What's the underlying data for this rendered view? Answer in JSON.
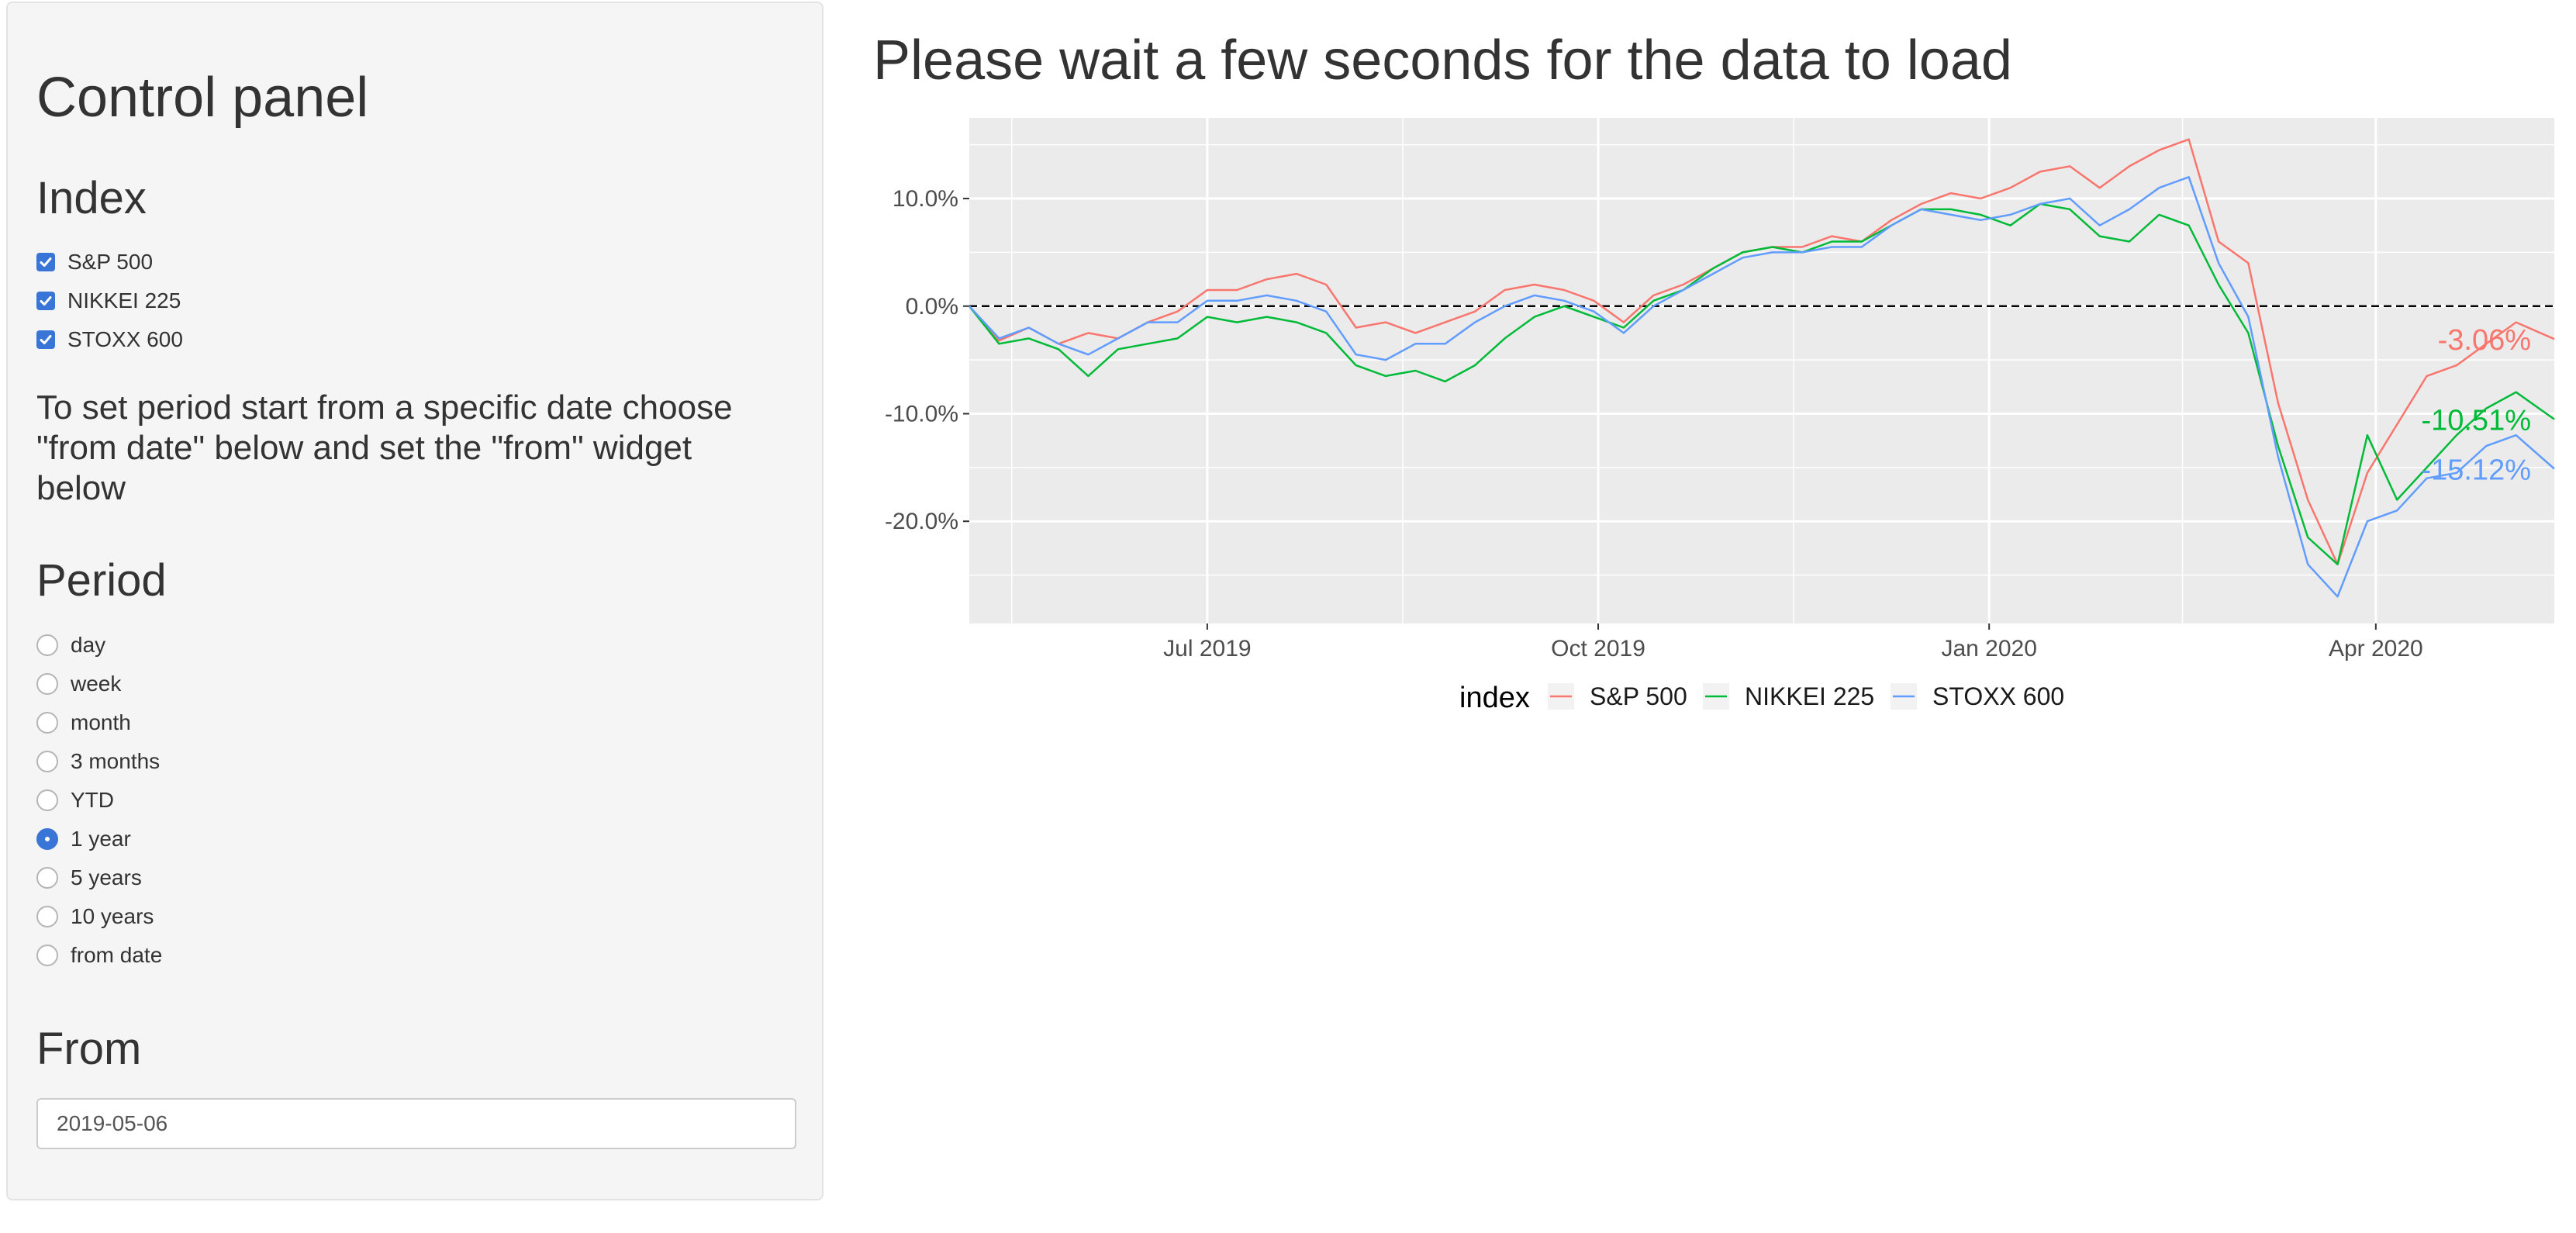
{
  "sidebar": {
    "title": "Control panel",
    "index": {
      "heading": "Index",
      "items": [
        {
          "label": "S&P 500",
          "checked": true
        },
        {
          "label": "NIKKEI 225",
          "checked": true
        },
        {
          "label": "STOXX 600",
          "checked": true
        }
      ]
    },
    "note": "To set period start from a specific date choose \"from date\" below and set the \"from\" widget below",
    "period": {
      "heading": "Period",
      "options": [
        "day",
        "week",
        "month",
        "3 months",
        "YTD",
        "1 year",
        "5 years",
        "10 years",
        "from date"
      ],
      "selected": "1 year"
    },
    "from": {
      "heading": "From",
      "value": "2019-05-06"
    }
  },
  "main": {
    "title": "Please wait a few seconds for the data to load"
  },
  "colors": {
    "sp500": "#F8766D",
    "nikkei": "#00BA38",
    "stoxx": "#619CFF",
    "accent": "#3875d7",
    "panel_bg": "#EBEBEB"
  },
  "chart_data": {
    "type": "line",
    "x_axis": {
      "type": "date",
      "range": [
        "2019-05-06",
        "2020-05-13"
      ],
      "tick_labels": [
        {
          "date": "2019-07-01",
          "label": "Jul 2019"
        },
        {
          "date": "2019-10-01",
          "label": "Oct 2019"
        },
        {
          "date": "2020-01-01",
          "label": "Jan 2020"
        },
        {
          "date": "2020-04-01",
          "label": "Apr 2020"
        }
      ]
    },
    "y_axis": {
      "unit": "percent",
      "range": [
        -29.5,
        17.5
      ],
      "ticks": [
        10,
        0,
        -10,
        -20
      ],
      "tick_labels": [
        "10.0%",
        "0.0%",
        "-10.0%",
        "-20.0%"
      ]
    },
    "reference_line": {
      "y": 0,
      "style": "dashed"
    },
    "grid": true,
    "legend": {
      "title": "index",
      "position": "bottom",
      "entries": [
        "S&P 500",
        "NIKKEI 225",
        "STOXX 600"
      ]
    },
    "series": [
      {
        "name": "S&P 500",
        "color": "#F8766D",
        "end_label": "-3.06%",
        "points": [
          [
            "2019-05-06",
            0.0
          ],
          [
            "2019-05-13",
            -3.2
          ],
          [
            "2019-05-20",
            -2.0
          ],
          [
            "2019-05-27",
            -3.5
          ],
          [
            "2019-06-03",
            -2.5
          ],
          [
            "2019-06-10",
            -3.0
          ],
          [
            "2019-06-17",
            -1.5
          ],
          [
            "2019-06-24",
            -0.5
          ],
          [
            "2019-07-01",
            1.5
          ],
          [
            "2019-07-08",
            1.5
          ],
          [
            "2019-07-15",
            2.5
          ],
          [
            "2019-07-22",
            3.0
          ],
          [
            "2019-07-29",
            2.0
          ],
          [
            "2019-08-05",
            -2.0
          ],
          [
            "2019-08-12",
            -1.5
          ],
          [
            "2019-08-19",
            -2.5
          ],
          [
            "2019-08-26",
            -1.5
          ],
          [
            "2019-09-02",
            -0.5
          ],
          [
            "2019-09-09",
            1.5
          ],
          [
            "2019-09-16",
            2.0
          ],
          [
            "2019-09-23",
            1.5
          ],
          [
            "2019-09-30",
            0.5
          ],
          [
            "2019-10-07",
            -1.5
          ],
          [
            "2019-10-14",
            1.0
          ],
          [
            "2019-10-21",
            2.0
          ],
          [
            "2019-10-28",
            3.5
          ],
          [
            "2019-11-04",
            5.0
          ],
          [
            "2019-11-11",
            5.5
          ],
          [
            "2019-11-18",
            5.5
          ],
          [
            "2019-11-25",
            6.5
          ],
          [
            "2019-12-02",
            6.0
          ],
          [
            "2019-12-09",
            8.0
          ],
          [
            "2019-12-16",
            9.5
          ],
          [
            "2019-12-23",
            10.5
          ],
          [
            "2019-12-30",
            10.0
          ],
          [
            "2020-01-06",
            11.0
          ],
          [
            "2020-01-13",
            12.5
          ],
          [
            "2020-01-20",
            13.0
          ],
          [
            "2020-01-27",
            11.0
          ],
          [
            "2020-02-03",
            13.0
          ],
          [
            "2020-02-10",
            14.5
          ],
          [
            "2020-02-17",
            15.5
          ],
          [
            "2020-02-24",
            6.0
          ],
          [
            "2020-03-02",
            4.0
          ],
          [
            "2020-03-09",
            -9.0
          ],
          [
            "2020-03-16",
            -18.0
          ],
          [
            "2020-03-23",
            -24.0
          ],
          [
            "2020-03-30",
            -15.5
          ],
          [
            "2020-04-06",
            -11.0
          ],
          [
            "2020-04-13",
            -6.5
          ],
          [
            "2020-04-20",
            -5.5
          ],
          [
            "2020-04-27",
            -3.5
          ],
          [
            "2020-05-04",
            -1.5
          ],
          [
            "2020-05-13",
            -3.06
          ]
        ]
      },
      {
        "name": "NIKKEI 225",
        "color": "#00BA38",
        "end_label": "-10.51%",
        "points": [
          [
            "2019-05-06",
            0.0
          ],
          [
            "2019-05-13",
            -3.5
          ],
          [
            "2019-05-20",
            -3.0
          ],
          [
            "2019-05-27",
            -4.0
          ],
          [
            "2019-06-03",
            -6.5
          ],
          [
            "2019-06-10",
            -4.0
          ],
          [
            "2019-06-17",
            -3.5
          ],
          [
            "2019-06-24",
            -3.0
          ],
          [
            "2019-07-01",
            -1.0
          ],
          [
            "2019-07-08",
            -1.5
          ],
          [
            "2019-07-15",
            -1.0
          ],
          [
            "2019-07-22",
            -1.5
          ],
          [
            "2019-07-29",
            -2.5
          ],
          [
            "2019-08-05",
            -5.5
          ],
          [
            "2019-08-12",
            -6.5
          ],
          [
            "2019-08-19",
            -6.0
          ],
          [
            "2019-08-26",
            -7.0
          ],
          [
            "2019-09-02",
            -5.5
          ],
          [
            "2019-09-09",
            -3.0
          ],
          [
            "2019-09-16",
            -1.0
          ],
          [
            "2019-09-23",
            0.0
          ],
          [
            "2019-09-30",
            -1.0
          ],
          [
            "2019-10-07",
            -2.0
          ],
          [
            "2019-10-14",
            0.5
          ],
          [
            "2019-10-21",
            1.5
          ],
          [
            "2019-10-28",
            3.5
          ],
          [
            "2019-11-04",
            5.0
          ],
          [
            "2019-11-11",
            5.5
          ],
          [
            "2019-11-18",
            5.0
          ],
          [
            "2019-11-25",
            6.0
          ],
          [
            "2019-12-02",
            6.0
          ],
          [
            "2019-12-09",
            7.5
          ],
          [
            "2019-12-16",
            9.0
          ],
          [
            "2019-12-23",
            9.0
          ],
          [
            "2019-12-30",
            8.5
          ],
          [
            "2020-01-06",
            7.5
          ],
          [
            "2020-01-13",
            9.5
          ],
          [
            "2020-01-20",
            9.0
          ],
          [
            "2020-01-27",
            6.5
          ],
          [
            "2020-02-03",
            6.0
          ],
          [
            "2020-02-10",
            8.5
          ],
          [
            "2020-02-17",
            7.5
          ],
          [
            "2020-02-24",
            2.0
          ],
          [
            "2020-03-02",
            -2.5
          ],
          [
            "2020-03-09",
            -13.0
          ],
          [
            "2020-03-16",
            -21.5
          ],
          [
            "2020-03-23",
            -24.0
          ],
          [
            "2020-03-30",
            -12.0
          ],
          [
            "2020-04-06",
            -18.0
          ],
          [
            "2020-04-13",
            -15.0
          ],
          [
            "2020-04-20",
            -12.0
          ],
          [
            "2020-04-27",
            -9.5
          ],
          [
            "2020-05-04",
            -8.0
          ],
          [
            "2020-05-13",
            -10.51
          ]
        ]
      },
      {
        "name": "STOXX 600",
        "color": "#619CFF",
        "end_label": "-15.12%",
        "points": [
          [
            "2019-05-06",
            0.0
          ],
          [
            "2019-05-13",
            -3.0
          ],
          [
            "2019-05-20",
            -2.0
          ],
          [
            "2019-05-27",
            -3.5
          ],
          [
            "2019-06-03",
            -4.5
          ],
          [
            "2019-06-10",
            -3.0
          ],
          [
            "2019-06-17",
            -1.5
          ],
          [
            "2019-06-24",
            -1.5
          ],
          [
            "2019-07-01",
            0.5
          ],
          [
            "2019-07-08",
            0.5
          ],
          [
            "2019-07-15",
            1.0
          ],
          [
            "2019-07-22",
            0.5
          ],
          [
            "2019-07-29",
            -0.5
          ],
          [
            "2019-08-05",
            -4.5
          ],
          [
            "2019-08-12",
            -5.0
          ],
          [
            "2019-08-19",
            -3.5
          ],
          [
            "2019-08-26",
            -3.5
          ],
          [
            "2019-09-02",
            -1.5
          ],
          [
            "2019-09-09",
            0.0
          ],
          [
            "2019-09-16",
            1.0
          ],
          [
            "2019-09-23",
            0.5
          ],
          [
            "2019-09-30",
            -0.5
          ],
          [
            "2019-10-07",
            -2.5
          ],
          [
            "2019-10-14",
            0.0
          ],
          [
            "2019-10-21",
            1.5
          ],
          [
            "2019-10-28",
            3.0
          ],
          [
            "2019-11-04",
            4.5
          ],
          [
            "2019-11-11",
            5.0
          ],
          [
            "2019-11-18",
            5.0
          ],
          [
            "2019-11-25",
            5.5
          ],
          [
            "2019-12-02",
            5.5
          ],
          [
            "2019-12-09",
            7.5
          ],
          [
            "2019-12-16",
            9.0
          ],
          [
            "2019-12-23",
            8.5
          ],
          [
            "2019-12-30",
            8.0
          ],
          [
            "2020-01-06",
            8.5
          ],
          [
            "2020-01-13",
            9.5
          ],
          [
            "2020-01-20",
            10.0
          ],
          [
            "2020-01-27",
            7.5
          ],
          [
            "2020-02-03",
            9.0
          ],
          [
            "2020-02-10",
            11.0
          ],
          [
            "2020-02-17",
            12.0
          ],
          [
            "2020-02-24",
            4.0
          ],
          [
            "2020-03-02",
            -1.0
          ],
          [
            "2020-03-09",
            -14.0
          ],
          [
            "2020-03-16",
            -24.0
          ],
          [
            "2020-03-23",
            -27.0
          ],
          [
            "2020-03-30",
            -20.0
          ],
          [
            "2020-04-06",
            -19.0
          ],
          [
            "2020-04-13",
            -16.0
          ],
          [
            "2020-04-20",
            -15.5
          ],
          [
            "2020-04-27",
            -13.0
          ],
          [
            "2020-05-04",
            -12.0
          ],
          [
            "2020-05-13",
            -15.12
          ]
        ]
      }
    ]
  }
}
